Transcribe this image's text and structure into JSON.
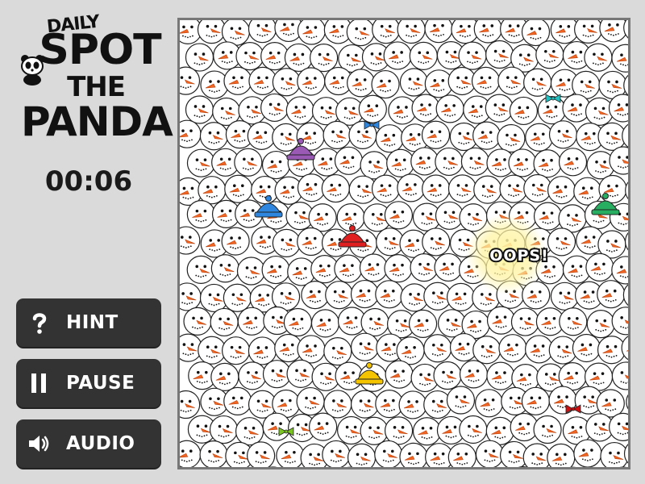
{
  "logo": {
    "line1": "DAILY",
    "line2": "SPOT",
    "line3": "THE",
    "line4": "PANDA"
  },
  "timer": {
    "value": "00:06"
  },
  "buttons": {
    "hint": {
      "label": "HINT",
      "icon": "question-icon"
    },
    "pause": {
      "label": "PAUSE",
      "icon": "pause-icon"
    },
    "audio": {
      "label": "AUDIO",
      "icon": "speaker-icon"
    }
  },
  "board": {
    "feedback": "OOPS!",
    "colors": {
      "background": "#ffffff",
      "carrot": "#f26522",
      "hat_purple": "#9b59b6",
      "hat_blue": "#2e86de",
      "hat_red": "#e02020",
      "hat_green": "#27ae60",
      "hat_yellow": "#f5c400",
      "bow_blue": "#2e86de",
      "bow_teal": "#20c0c0",
      "bow_red": "#d01010",
      "bow_green": "#7ac520",
      "highlight": "#fff3a0"
    }
  }
}
